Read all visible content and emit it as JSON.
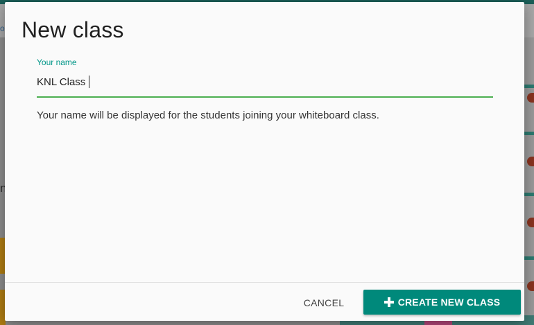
{
  "dialog": {
    "title": "New class",
    "field": {
      "label": "Your name",
      "value": "KNL Class"
    },
    "helper_text": "Your name will be displayed for the students joining your whiteboard class.",
    "buttons": {
      "cancel_label": "CANCEL",
      "create_label": "CREATE NEW CLASS",
      "create_icon": "plus-icon"
    }
  },
  "background": {
    "left_text": "n",
    "link_text": "o"
  },
  "colors": {
    "accent": "#009688",
    "primary_button": "#00897b",
    "underline": "#4caf50"
  }
}
